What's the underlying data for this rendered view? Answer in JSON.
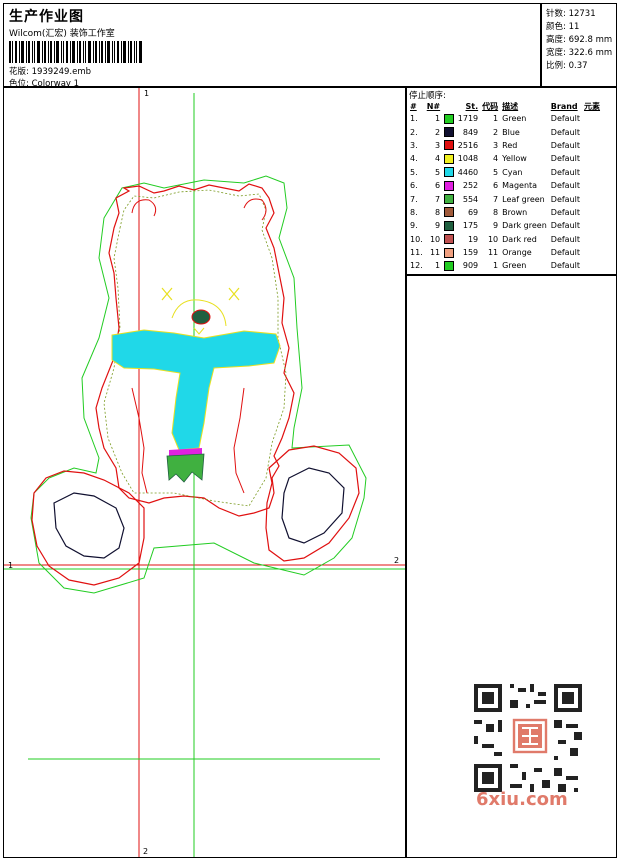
{
  "header": {
    "title": "生产作业图",
    "subtitle": "Wilcom(汇宏) 装饰工作室",
    "design_label": "花版:",
    "design_value": "1939249.emb",
    "colorway_label": "色位:",
    "colorway_value": "Colorway 1"
  },
  "stats": {
    "stitches_label": "针数:",
    "stitches_value": "12731",
    "colors_label": "颜色:",
    "colors_value": "11",
    "height_label": "高度:",
    "height_value": "692.8 mm",
    "width_label": "宽度:",
    "width_value": "322.6 mm",
    "scale_label": "比例:",
    "scale_value": "0.37"
  },
  "legend": {
    "title": "停止顺序:",
    "headers": [
      "#",
      "N#",
      "St.",
      "代码",
      "描述",
      "Brand",
      "元素"
    ],
    "rows": [
      {
        "idx": "1.",
        "n": "1",
        "color": "#22cc22",
        "st": "1719",
        "code": "1",
        "desc": "Green",
        "brand": "Default"
      },
      {
        "idx": "2.",
        "n": "2",
        "color": "#101030",
        "st": "849",
        "code": "2",
        "desc": "Blue",
        "brand": "Default"
      },
      {
        "idx": "3.",
        "n": "3",
        "color": "#e01010",
        "st": "2516",
        "code": "3",
        "desc": "Red",
        "brand": "Default"
      },
      {
        "idx": "4.",
        "n": "4",
        "color": "#f0f020",
        "st": "1048",
        "code": "4",
        "desc": "Yellow",
        "brand": "Default"
      },
      {
        "idx": "5.",
        "n": "5",
        "color": "#20d8e8",
        "st": "4460",
        "code": "5",
        "desc": "Cyan",
        "brand": "Default"
      },
      {
        "idx": "6.",
        "n": "6",
        "color": "#e020e0",
        "st": "252",
        "code": "6",
        "desc": "Magenta",
        "brand": "Default"
      },
      {
        "idx": "7.",
        "n": "7",
        "color": "#40b040",
        "st": "554",
        "code": "7",
        "desc": "Leaf green",
        "brand": "Default"
      },
      {
        "idx": "8.",
        "n": "8",
        "color": "#a05a3a",
        "st": "69",
        "code": "8",
        "desc": "Brown",
        "brand": "Default"
      },
      {
        "idx": "9.",
        "n": "9",
        "color": "#206040",
        "st": "175",
        "code": "9",
        "desc": "Dark green",
        "brand": "Default"
      },
      {
        "idx": "10.",
        "n": "10",
        "color": "#c05050",
        "st": "19",
        "code": "10",
        "desc": "Dark red",
        "brand": "Default"
      },
      {
        "idx": "11.",
        "n": "11",
        "color": "#f0a080",
        "st": "159",
        "code": "11",
        "desc": "Orange",
        "brand": "Default"
      },
      {
        "idx": "12.",
        "n": "1",
        "color": "#22cc22",
        "st": "909",
        "code": "1",
        "desc": "Green",
        "brand": "Default"
      }
    ]
  },
  "axes": {
    "top": "1",
    "left": "1",
    "right": "2",
    "bottom": "2"
  },
  "watermark": "6xiu.com"
}
